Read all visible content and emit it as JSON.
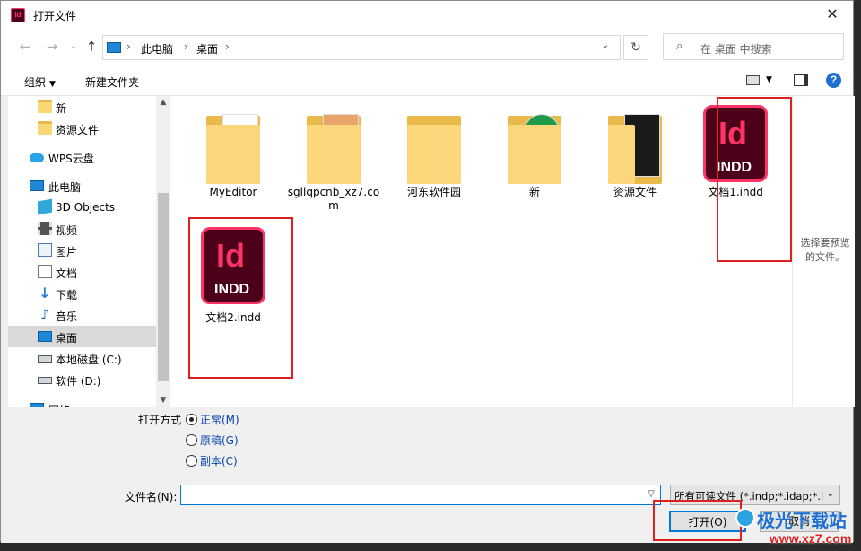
{
  "window": {
    "title": "打开文件",
    "close": "✕"
  },
  "nav": {
    "back": "←",
    "forward": "→",
    "dropdown": "⌄",
    "up": "↑",
    "refresh": "↻"
  },
  "address": {
    "crumb1": "此电脑",
    "crumb2": "桌面",
    "sep": "›"
  },
  "search": {
    "placeholder": "在 桌面 中搜索",
    "icon": "⌕"
  },
  "toolbar": {
    "organize": "组织",
    "new_folder": "新建文件夹",
    "help": "?"
  },
  "sidebar": {
    "items": [
      {
        "label": "新"
      },
      {
        "label": "资源文件"
      },
      {
        "label": "WPS云盘"
      },
      {
        "label": "此电脑"
      },
      {
        "label": "3D Objects"
      },
      {
        "label": "视频"
      },
      {
        "label": "图片"
      },
      {
        "label": "文档"
      },
      {
        "label": "下载"
      },
      {
        "label": "音乐"
      },
      {
        "label": "桌面"
      },
      {
        "label": "本地磁盘 (C:)"
      },
      {
        "label": "软件 (D:)"
      },
      {
        "label": "网络"
      }
    ],
    "down_arrow": "↓",
    "note": "♪"
  },
  "files": [
    {
      "label": "MyEditor"
    },
    {
      "label": "sgllqpcnb_xz7.com"
    },
    {
      "label": "河东软件园"
    },
    {
      "label": "新"
    },
    {
      "label": "资源文件"
    },
    {
      "label": "文档1.indd"
    },
    {
      "label": "文档2.indd"
    }
  ],
  "indd": {
    "mark": "Id",
    "ext": "INDD"
  },
  "preview": {
    "text": "选择要预览的文件。"
  },
  "open_mode": {
    "label": "打开方式",
    "options": [
      {
        "label": "正常(M)",
        "selected": true
      },
      {
        "label": "原稿(G)",
        "selected": false
      },
      {
        "label": "副本(C)",
        "selected": false
      }
    ]
  },
  "filename": {
    "label": "文件名(N):",
    "value": ""
  },
  "filetype": {
    "value": "所有可读文件 (*.indp;*.idap;*.i"
  },
  "buttons": {
    "open": "打开(O)",
    "cancel": "取消"
  },
  "watermark": {
    "line1": "极光下载站",
    "line2": "www.xz7.com"
  },
  "colors": {
    "accent": "#0078d7",
    "indesign": "#ff3366",
    "highlight": "#e02020"
  }
}
